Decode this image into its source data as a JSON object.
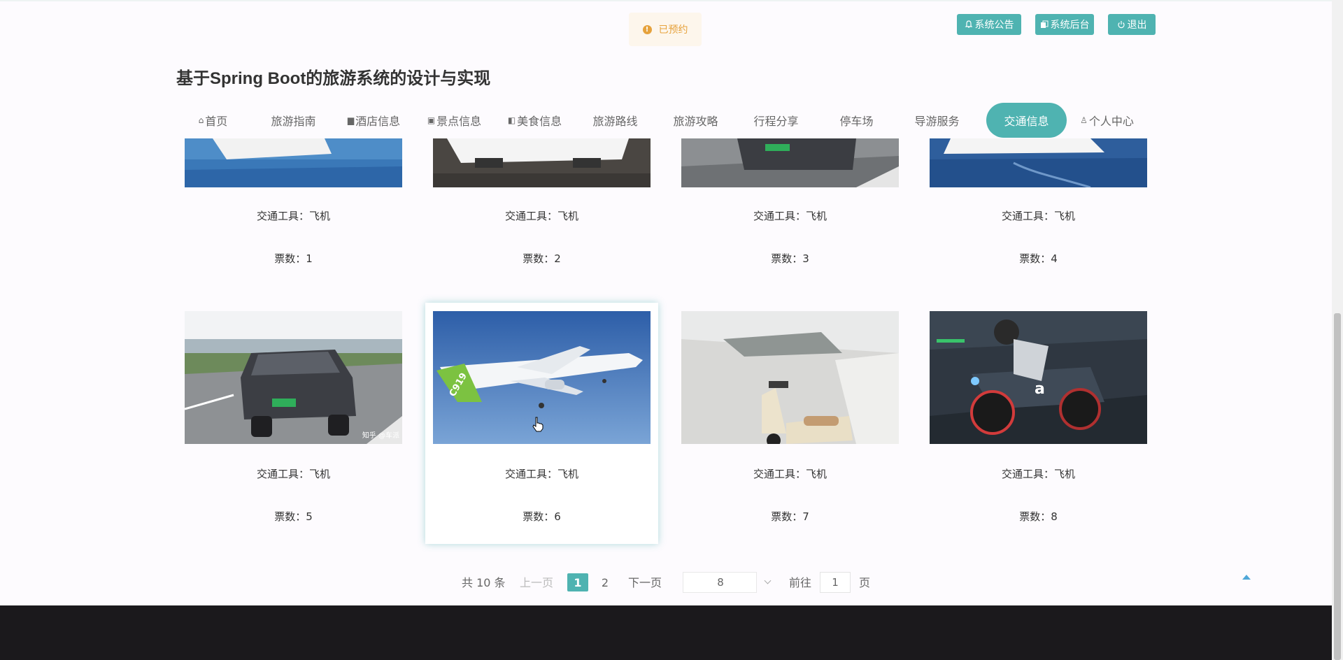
{
  "toast": {
    "text": "已预约"
  },
  "top_buttons": {
    "notice": "系统公告",
    "admin": "系统后台",
    "logout": "退出"
  },
  "page_title": "基于Spring Boot的旅游系统的设计与实现",
  "nav": [
    {
      "label": "首页",
      "icon": "home-icon"
    },
    {
      "label": "旅游指南",
      "icon": ""
    },
    {
      "label": "酒店信息",
      "icon": "hotel-icon"
    },
    {
      "label": "景点信息",
      "icon": "scenic-icon"
    },
    {
      "label": "美食信息",
      "icon": "food-icon"
    },
    {
      "label": "旅游路线",
      "icon": ""
    },
    {
      "label": "旅游攻略",
      "icon": ""
    },
    {
      "label": "行程分享",
      "icon": ""
    },
    {
      "label": "停车场",
      "icon": ""
    },
    {
      "label": "导游服务",
      "icon": ""
    },
    {
      "label": "交通信息",
      "icon": "",
      "active": true
    },
    {
      "label": "个人中心",
      "icon": "user-icon"
    }
  ],
  "cards": [
    {
      "tool": "交通工具：飞机",
      "tickets": "票数：1",
      "image": "ship-photo"
    },
    {
      "tool": "交通工具：飞机",
      "tickets": "票数：2",
      "image": "train-photo"
    },
    {
      "tool": "交通工具：飞机",
      "tickets": "票数：3",
      "image": "car-photo"
    },
    {
      "tool": "交通工具：飞机",
      "tickets": "票数：4",
      "image": "cruise-photo"
    },
    {
      "tool": "交通工具：飞机",
      "tickets": "票数：5",
      "image": "suv-photo",
      "watermark": "知乎 @车派"
    },
    {
      "tool": "交通工具：飞机",
      "tickets": "票数：6",
      "image": "airplane-photo",
      "plane_tail": "C919"
    },
    {
      "tool": "交通工具：飞机",
      "tickets": "票数：7",
      "image": "scooter-photo"
    },
    {
      "tool": "交通工具：飞机",
      "tickets": "票数：8",
      "image": "motorcycle-photo"
    }
  ],
  "pagination": {
    "total": "共 10 条",
    "prev": "上一页",
    "pages": [
      "1",
      "2"
    ],
    "current": "1",
    "next": "下一页",
    "page_size": "8",
    "goto": "前往",
    "goto_value": "1",
    "page_unit": "页"
  },
  "colors": {
    "accent": "#4fb3b1",
    "warning": "#e6a23c",
    "footer": "#1b191c"
  }
}
